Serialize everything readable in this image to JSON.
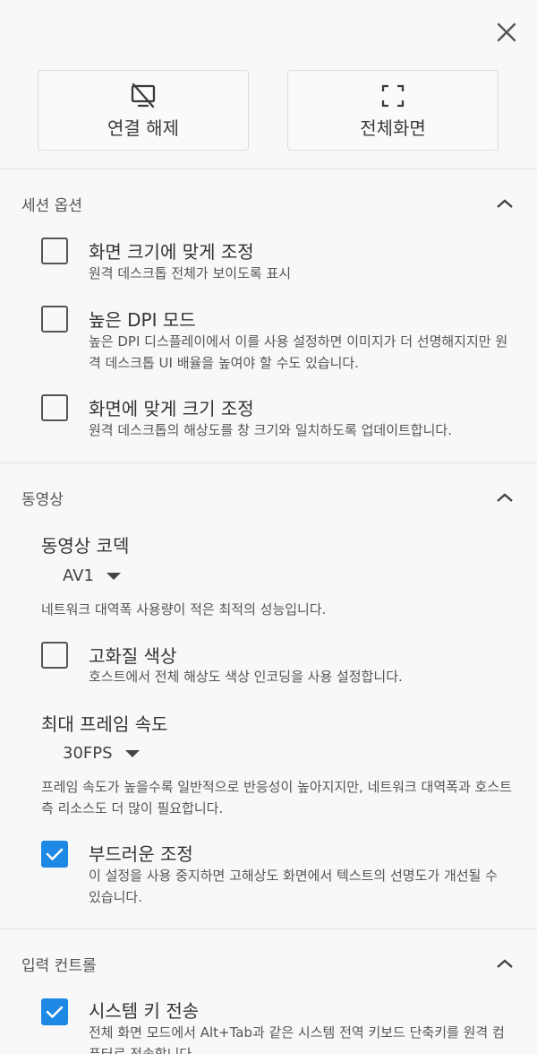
{
  "top_buttons": {
    "disconnect_label": "연결 해제",
    "fullscreen_label": "전체화면"
  },
  "sections": {
    "session": {
      "title": "세션 옵션",
      "options": [
        {
          "title": "화면 크기에 맞게 조정",
          "desc": "원격 데스크톱 전체가 보이도록 표시",
          "checked": false
        },
        {
          "title": "높은 DPI 모드",
          "desc": "높은 DPI 디스플레이에서 이를 사용 설정하면 이미지가 더 선명해지지만 원격 데스크톱 UI 배율을 높여야 할 수도 있습니다.",
          "checked": false
        },
        {
          "title": "화면에 맞게 크기 조정",
          "desc": "원격 데스크톱의 해상도를 창 크기와 일치하도록 업데이트합니다.",
          "checked": false
        }
      ]
    },
    "video": {
      "title": "동영상",
      "codec": {
        "title": "동영상 코덱",
        "value": "AV1",
        "note": "네트워크 대역폭 사용량이 적은 최적의 성능입니다."
      },
      "high_quality": {
        "title": "고화질 색상",
        "desc": "호스트에서 전체 해상도 색상 인코딩을 사용 설정합니다.",
        "checked": false
      },
      "framerate": {
        "title": "최대 프레임 속도",
        "value": "30FPS",
        "note": "프레임 속도가 높을수록 일반적으로 반응성이 높아지지만, 네트워크 대역폭과 호스트 측 리소스도 더 많이 필요합니다."
      },
      "smooth": {
        "title": "부드러운 조정",
        "desc": "이 설정을 사용 중지하면 고해상도 화면에서 텍스트의 선명도가 개선될 수 있습니다.",
        "checked": true
      }
    },
    "input": {
      "title": "입력 컨트롤",
      "system_keys": {
        "title": "시스템 키 전송",
        "desc": "전체 화면 모드에서 Alt+Tab과 같은 시스템 전역 키보드 단축키를 원격 컴퓨터로 전송합니다.",
        "checked": true
      }
    }
  },
  "colors": {
    "accent": "#1e88e5"
  }
}
